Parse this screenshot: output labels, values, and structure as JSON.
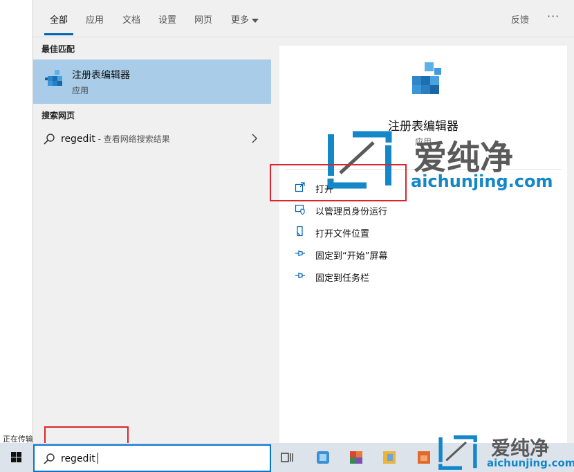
{
  "status": {
    "left_text": "正在传输"
  },
  "tabs": [
    {
      "label": "全部",
      "active": true
    },
    {
      "label": "应用"
    },
    {
      "label": "文档"
    },
    {
      "label": "设置"
    },
    {
      "label": "网页"
    },
    {
      "label": "更多"
    }
  ],
  "header": {
    "feedback_label": "反馈",
    "more_label": "···"
  },
  "best_match": {
    "section_title": "最佳匹配",
    "name": "注册表编辑器",
    "type": "应用"
  },
  "web": {
    "section_title": "搜索网页",
    "query": "regedit",
    "suffix": " - 查看网络搜索结果"
  },
  "detail": {
    "name": "注册表编辑器",
    "type": "应用",
    "actions": [
      {
        "label": "打开",
        "icon": "open-icon"
      },
      {
        "label": "以管理员身份运行",
        "icon": "shield-run-icon"
      },
      {
        "label": "打开文件位置",
        "icon": "file-location-icon"
      },
      {
        "label": "固定到“开始”屏幕",
        "icon": "pin-icon"
      },
      {
        "label": "固定到任务栏",
        "icon": "pin-icon"
      }
    ]
  },
  "search": {
    "value": "regedit"
  },
  "watermark": {
    "brand": "爱纯净",
    "url": "aichunjing.com"
  },
  "colors": {
    "selected_bg": "#a9cde8",
    "accent": "#0063b1",
    "highlight_red": "#d9252b",
    "watermark_blue": "#1487c9"
  }
}
